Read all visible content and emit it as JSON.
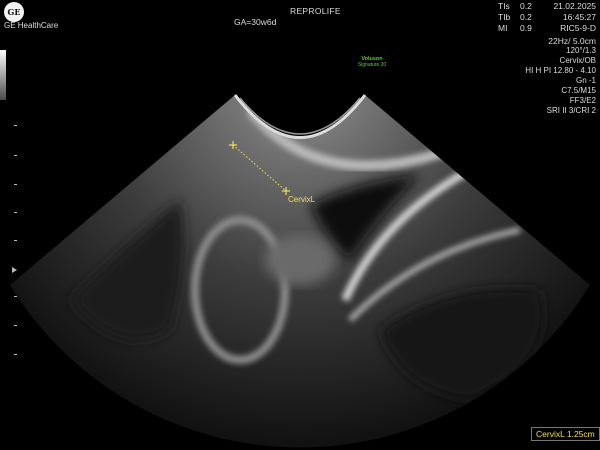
{
  "header": {
    "logo_text": "GE",
    "brand": "GE HealthCare",
    "site": "REPROLIFE",
    "gestational_age": "GA=30w6d"
  },
  "indices": [
    {
      "key": "TIs",
      "value": "0.2"
    },
    {
      "key": "TIb",
      "value": "0.2"
    },
    {
      "key": "MI",
      "value": "0.9"
    }
  ],
  "datetime": {
    "date": "21.02.2025",
    "time": "16:45:27",
    "probe": "RIC5-9-D"
  },
  "params": [
    "22Hz/ 5.0cm",
    "120°/1.3",
    "Cervix/OB",
    "HI H PI 12.80 - 4.10",
    "Gn -1",
    "C7.5/M15",
    "FF3/E2",
    "SRI II 3/CRI 2"
  ],
  "voluson": {
    "line1": "Voluson",
    "line2": "Signature 20"
  },
  "measurement": {
    "caliper_label": "CervixL",
    "result": "CervixL 1.25cm"
  },
  "colors": {
    "caliper": "#f4e04d",
    "voluson_badge": "#5ecb3a"
  }
}
